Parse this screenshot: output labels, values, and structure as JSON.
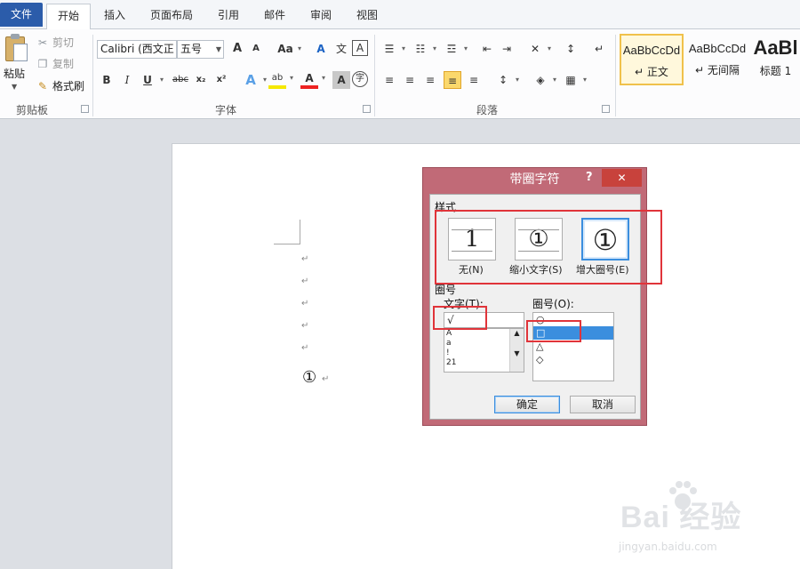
{
  "ribbon_tabs": [
    "文件",
    "开始",
    "插入",
    "页面布局",
    "引用",
    "邮件",
    "审阅",
    "视图"
  ],
  "active_tab": "开始",
  "clipboard": {
    "paste": "粘贴",
    "cut": "剪切",
    "copy": "复制",
    "format_painter": "格式刷",
    "group_label": "剪贴板"
  },
  "font": {
    "font_name": "Calibri (西文正",
    "font_size": "五号",
    "group_label": "字体",
    "buttons": {
      "grow": "A",
      "shrink": "A",
      "case": "Aa",
      "clear": "A",
      "phonetic": "文",
      "border": "A",
      "bold": "B",
      "italic": "I",
      "underline": "U",
      "strike": "abc",
      "sub": "x₂",
      "sup": "x²",
      "effects": "A",
      "highlight": "ab",
      "color": "A",
      "shading": "A",
      "enclose": "字"
    }
  },
  "paragraph": {
    "group_label": "段落",
    "buttons": {
      "bullets": "☰",
      "numbering": "☷",
      "multilevel": "☲",
      "decrease_indent": "⇤",
      "increase_indent": "⇥",
      "chinese_layout": "✕",
      "sort": "↕",
      "show_marks": "↵",
      "align_left": "≡",
      "center": "≡",
      "align_right": "≡",
      "justify": "≡",
      "distributed": "≡",
      "line_spacing": "↕",
      "shading": "◈",
      "borders": "▦"
    }
  },
  "styles": [
    {
      "sample": "AaBbCcDd",
      "name": "正文"
    },
    {
      "sample": "AaBbCcDd",
      "name": "无间隔"
    },
    {
      "sample": "AaBl",
      "name": "标题 1"
    }
  ],
  "document": {
    "para_mark": "↵",
    "enclosed_char": "①"
  },
  "dialog": {
    "title": "带圈字符",
    "help": "?",
    "close": "✕",
    "style_section": "样式",
    "style_options": [
      {
        "glyph": "1",
        "label": "无(N)"
      },
      {
        "glyph": "①",
        "label": "缩小文字(S)"
      },
      {
        "glyph": "①",
        "label": "增大圈号(E)"
      }
    ],
    "selected_style": "增大圈号(E)",
    "enclosure_section": "圈号",
    "text_label": "文字(T):",
    "text_value": "√",
    "text_list": [
      "A",
      "a",
      "!",
      "21"
    ],
    "enclosure_label": "圈号(O):",
    "enclosure_list": [
      "○",
      "□",
      "△",
      "◇"
    ],
    "selected_enclosure": "□",
    "ok": "确定",
    "cancel": "取消"
  },
  "watermark": {
    "logo": "Bai 经验",
    "url": "jingyan.baidu.com"
  },
  "colors": {
    "file_tab": "#2b5caa",
    "dialog_frame": "#c16a77",
    "dialog_close": "#c8423c",
    "selection": "#3b8ede",
    "highlight_box": "#e0343a"
  }
}
